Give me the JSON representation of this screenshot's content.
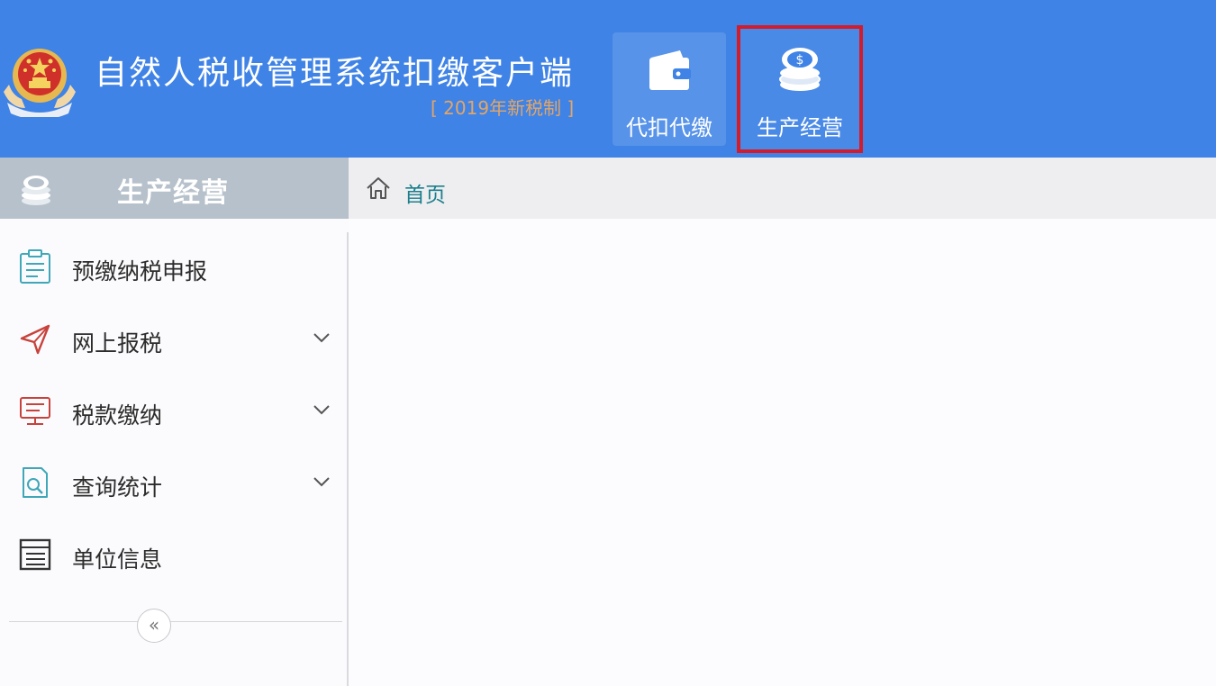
{
  "header": {
    "title": "自然人税收管理系统扣缴客户端",
    "subtitle": "[ 2019年新税制 ]",
    "emblem_icon": "national-emblem-icon",
    "bg_color": "#3f83e6"
  },
  "top_nav": [
    {
      "label": "代扣代缴",
      "icon": "wallet-icon"
    },
    {
      "label": "生产经营",
      "icon": "coin-stack-icon",
      "highlight_color": "#d21c2c"
    }
  ],
  "sidebar": {
    "title": "生产经营",
    "title_icon": "coin-stack-icon",
    "items": [
      {
        "label": "预缴纳税申报",
        "icon": "clipboard-icon",
        "has_submenu": false
      },
      {
        "label": "网上报税",
        "icon": "send-icon",
        "has_submenu": true
      },
      {
        "label": "税款缴纳",
        "icon": "monitor-icon",
        "has_submenu": true
      },
      {
        "label": "查询统计",
        "icon": "search-document-icon",
        "has_submenu": true
      },
      {
        "label": "单位信息",
        "icon": "list-icon",
        "has_submenu": false
      }
    ],
    "collapse_glyph": "«"
  },
  "breadcrumb": {
    "home_label": "首页",
    "home_icon": "home-icon"
  }
}
